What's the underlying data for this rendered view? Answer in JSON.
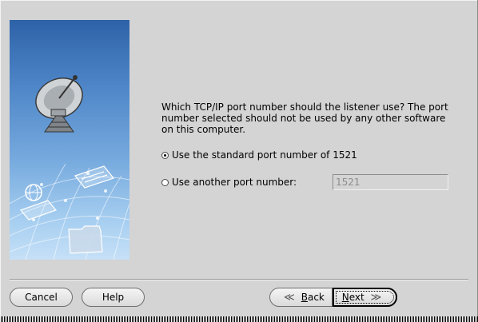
{
  "dialog": {
    "question": "Which TCP/IP port number should the listener use? The port number selected should not be used by any other software on this computer.",
    "options": [
      {
        "label": "Use the standard port number of 1521",
        "selected": true
      },
      {
        "label": "Use another port number:",
        "selected": false
      }
    ],
    "port_field_value": "1521",
    "port_field_enabled": false
  },
  "buttons": {
    "cancel": "Cancel",
    "help": "Help",
    "back": "Back",
    "next": "Next"
  },
  "icons": {
    "banner": [
      "satellite-dish-icon",
      "globe-icon",
      "document-icon",
      "folder-icon"
    ],
    "back": "chevron-left-icon",
    "next": "chevron-right-icon"
  },
  "colors": {
    "window_bg": "#d4d4d4",
    "banner_top": "#2e62a8",
    "banner_bottom": "#c6e0f7"
  }
}
